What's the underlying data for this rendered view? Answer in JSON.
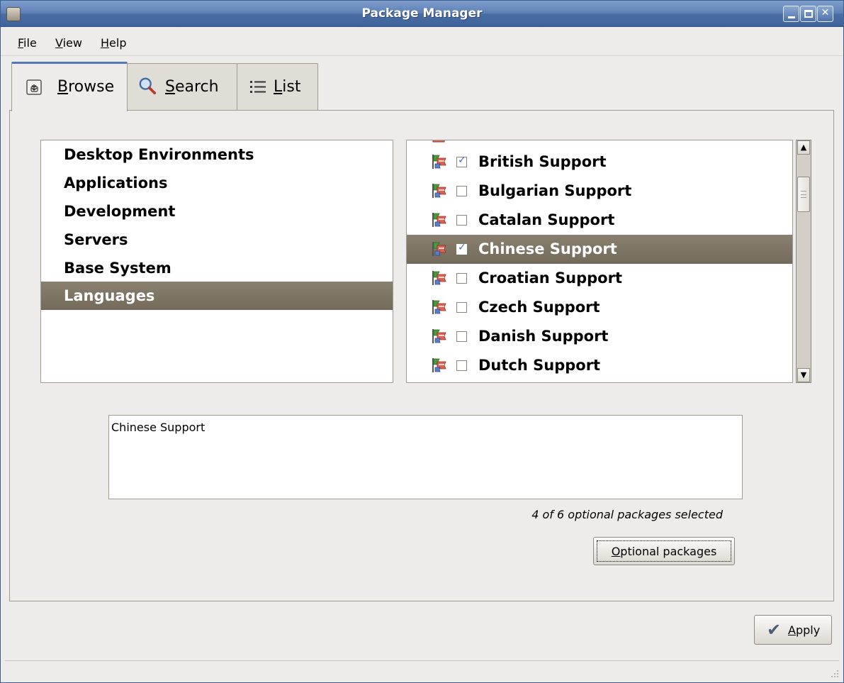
{
  "window": {
    "title": "Package Manager"
  },
  "menubar": {
    "items": [
      {
        "u": "F",
        "rest": "ile"
      },
      {
        "u": "V",
        "rest": "iew"
      },
      {
        "u": "H",
        "rest": "elp"
      }
    ]
  },
  "tabs": [
    {
      "u": "B",
      "rest": "rowse",
      "icon": "browse-icon"
    },
    {
      "u": "S",
      "rest": "earch",
      "icon": "search-icon"
    },
    {
      "u": "L",
      "rest": "ist",
      "icon": "list-icon"
    }
  ],
  "categories": [
    "Desktop Environments",
    "Applications",
    "Development",
    "Servers",
    "Base System",
    "Languages"
  ],
  "groups": [
    {
      "name": "British Support",
      "checked": "☑"
    },
    {
      "name": "Bulgarian Support",
      "checked": ""
    },
    {
      "name": "Catalan Support",
      "checked": ""
    },
    {
      "name": "Chinese Support",
      "checked": "☑"
    },
    {
      "name": "Croatian Support",
      "checked": ""
    },
    {
      "name": "Czech Support",
      "checked": ""
    },
    {
      "name": "Danish Support",
      "checked": ""
    },
    {
      "name": "Dutch Support",
      "checked": ""
    }
  ],
  "description": "Chinese Support",
  "optional_status": "4 of 6 optional packages selected",
  "buttons": {
    "optional_u": "O",
    "optional_rest": "ptional packages",
    "apply_u": "A",
    "apply_rest": "pply"
  },
  "colors": {
    "titlebar": "#4a6da5",
    "selection": "#7e7464",
    "background": "#edeceb"
  }
}
